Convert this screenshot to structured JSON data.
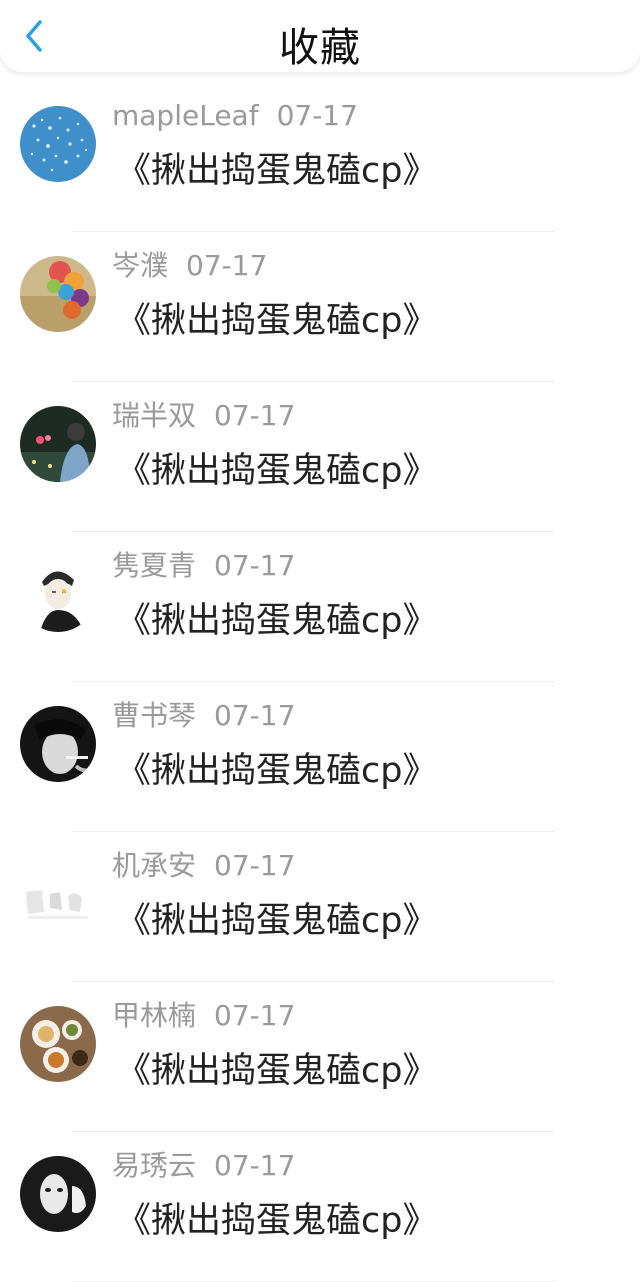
{
  "header": {
    "title": "收藏",
    "back_icon": "chevron-left-icon",
    "accent_color": "#2d9ee8"
  },
  "items": [
    {
      "user": "mapleLeaf",
      "date": "07-17",
      "title": "《揪出捣蛋鬼磕cp》",
      "avatar_icon": "blue-leaves-avatar"
    },
    {
      "user": "岑濮",
      "date": "07-17",
      "title": "《揪出捣蛋鬼磕cp》",
      "avatar_icon": "balloons-avatar"
    },
    {
      "user": "瑞半双",
      "date": "07-17",
      "title": "《揪出捣蛋鬼磕cp》",
      "avatar_icon": "night-girl-avatar"
    },
    {
      "user": "隽夏青",
      "date": "07-17",
      "title": "《揪出捣蛋鬼磕cp》",
      "avatar_icon": "sketch-boy-avatar"
    },
    {
      "user": "曹书琴",
      "date": "07-17",
      "title": "《揪出捣蛋鬼磕cp》",
      "avatar_icon": "smoking-person-avatar"
    },
    {
      "user": "机承安",
      "date": "07-17",
      "title": "《揪出捣蛋鬼磕cp》",
      "avatar_icon": "faded-sketch-avatar"
    },
    {
      "user": "甲林楠",
      "date": "07-17",
      "title": "《揪出捣蛋鬼磕cp》",
      "avatar_icon": "food-plate-avatar"
    },
    {
      "user": "易琇云",
      "date": "07-17",
      "title": "《揪出捣蛋鬼磕cp》",
      "avatar_icon": "masked-figure-avatar"
    }
  ]
}
